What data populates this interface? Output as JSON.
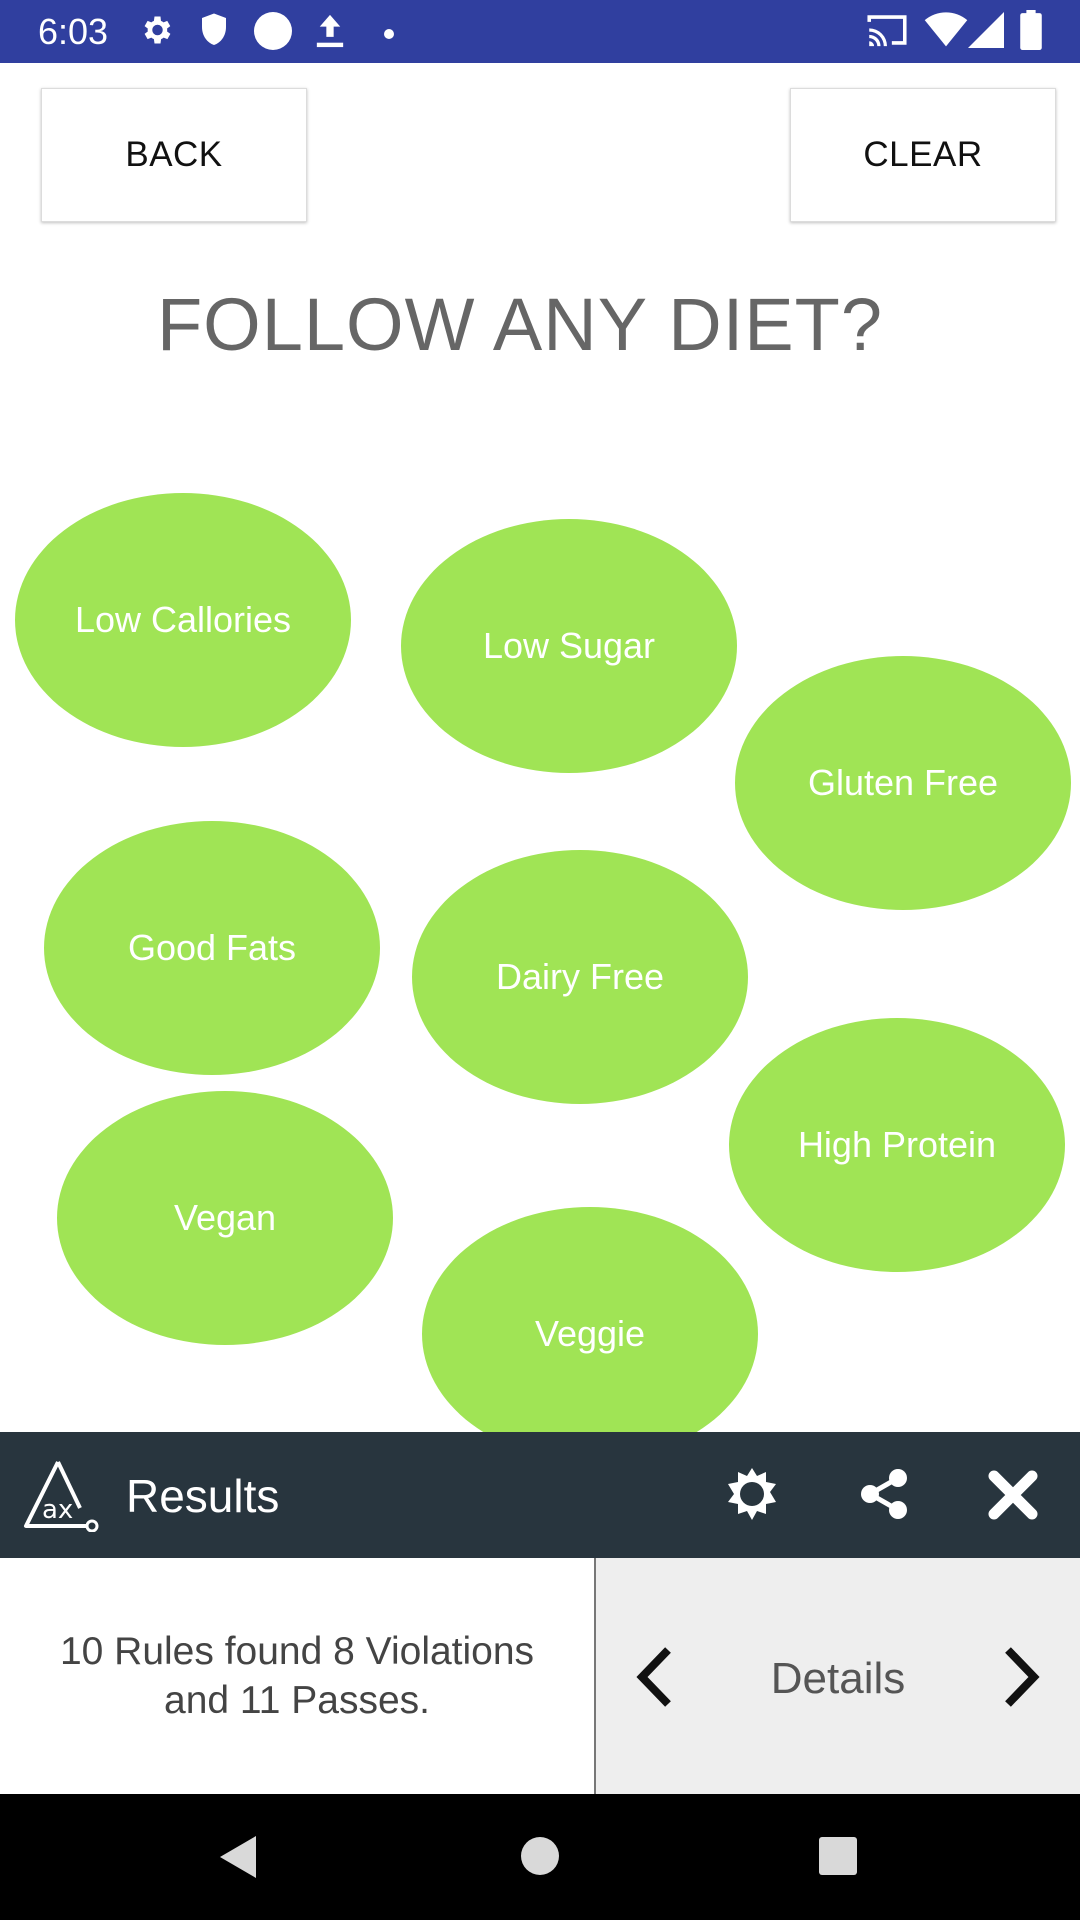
{
  "status_bar": {
    "time": "6:03",
    "left_icons": [
      "gear-icon",
      "shield-icon",
      "circle-icon",
      "upload-icon",
      "dot-icon"
    ],
    "right_icons": [
      "cast-icon",
      "wifi-icon",
      "signal-icon",
      "battery-icon"
    ]
  },
  "header": {
    "back_label": "BACK",
    "clear_label": "CLEAR"
  },
  "page": {
    "title": "FOLLOW ANY DIET?"
  },
  "diet_options": [
    "Low Callories",
    "Low Sugar",
    "Gluten Free",
    "Good Fats",
    "Dairy Free",
    "High Protein",
    "Vegan",
    "Veggie"
  ],
  "results": {
    "title": "Results",
    "summary": "10 Rules found 8 Violations and 11 Passes.",
    "details_label": "Details"
  },
  "colors": {
    "status_bar": "#303f9f",
    "bubble": "#a0e455",
    "results_bar": "#28353e",
    "details_bg": "#eeeeee"
  }
}
